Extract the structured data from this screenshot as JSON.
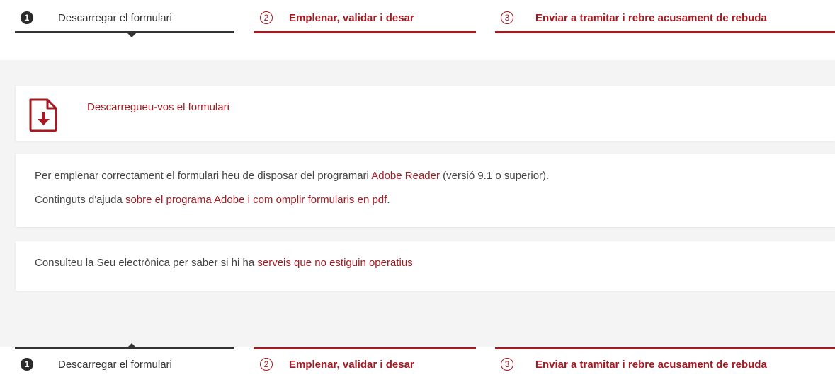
{
  "steps": [
    {
      "number": "1",
      "label": "Descarregar el formulari",
      "state": "active"
    },
    {
      "number": "2",
      "label": "Emplenar, validar i desar",
      "state": "todo"
    },
    {
      "number": "3",
      "label": "Enviar a tramitar i rebre acusament de rebuda",
      "state": "todo"
    }
  ],
  "download": {
    "icon": "pdf-download-icon",
    "link_label": "Descarregueu-vos el formulari"
  },
  "info": {
    "line1_pre": "Per emplenar correctament el formulari heu de disposar del programari ",
    "line1_link": "Adobe Reader",
    "line1_post": " (versió 9.1 o superior).",
    "line2_pre": "Continguts d'ajuda ",
    "line2_link": "sobre el programa Adobe i com omplir formularis en pdf",
    "line2_post": "."
  },
  "notice": {
    "pre": "Consulteu la Seu electrònica per saber si hi ha ",
    "link": "serveis que no estiguin operatius"
  },
  "colors": {
    "accent": "#a31a22",
    "active": "#2b2b2b",
    "panel_bg": "#f4f4f4"
  }
}
